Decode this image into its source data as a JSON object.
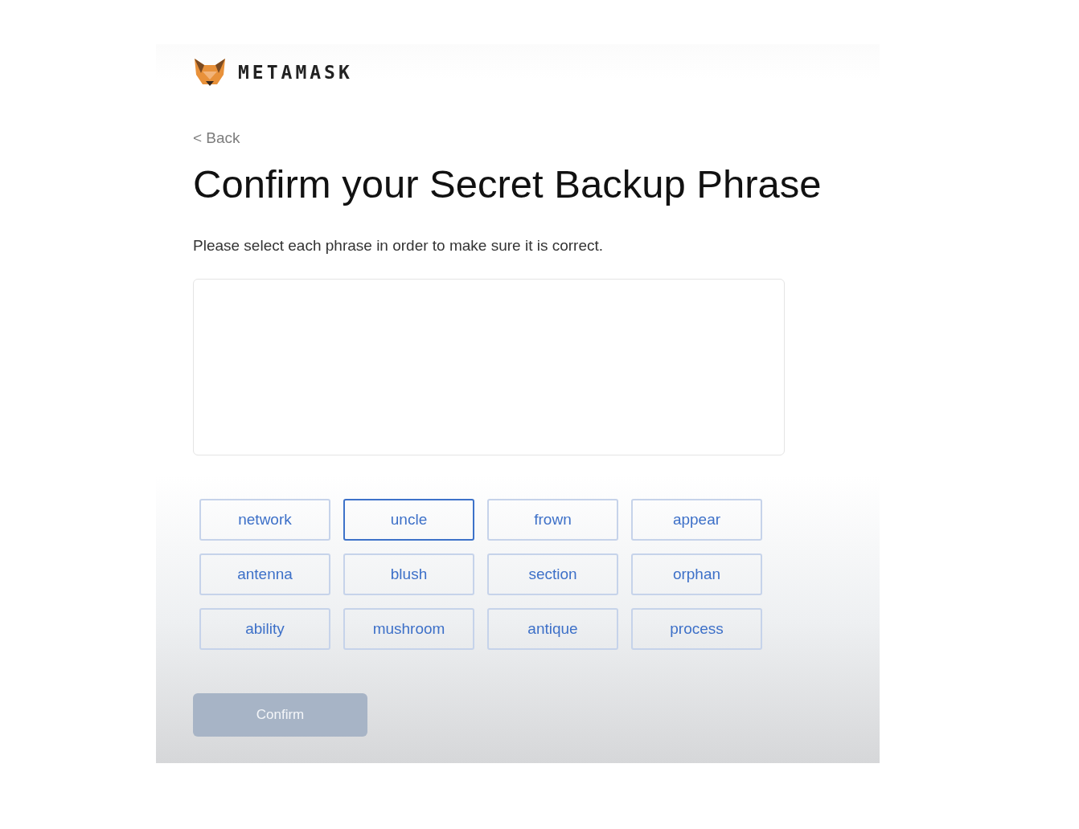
{
  "logo": {
    "wordmark": "METAMASK"
  },
  "back_link": "< Back",
  "title": "Confirm your Secret Backup Phrase",
  "instructions": "Please select each phrase in order to make sure it is correct.",
  "words": [
    {
      "label": "network",
      "selected": false
    },
    {
      "label": "uncle",
      "selected": true
    },
    {
      "label": "frown",
      "selected": false
    },
    {
      "label": "appear",
      "selected": false
    },
    {
      "label": "antenna",
      "selected": false
    },
    {
      "label": "blush",
      "selected": false
    },
    {
      "label": "section",
      "selected": false
    },
    {
      "label": "orphan",
      "selected": false
    },
    {
      "label": "ability",
      "selected": false
    },
    {
      "label": "mushroom",
      "selected": false
    },
    {
      "label": "antique",
      "selected": false
    },
    {
      "label": "process",
      "selected": false
    }
  ],
  "confirm_button": {
    "label": "Confirm",
    "disabled": true
  }
}
